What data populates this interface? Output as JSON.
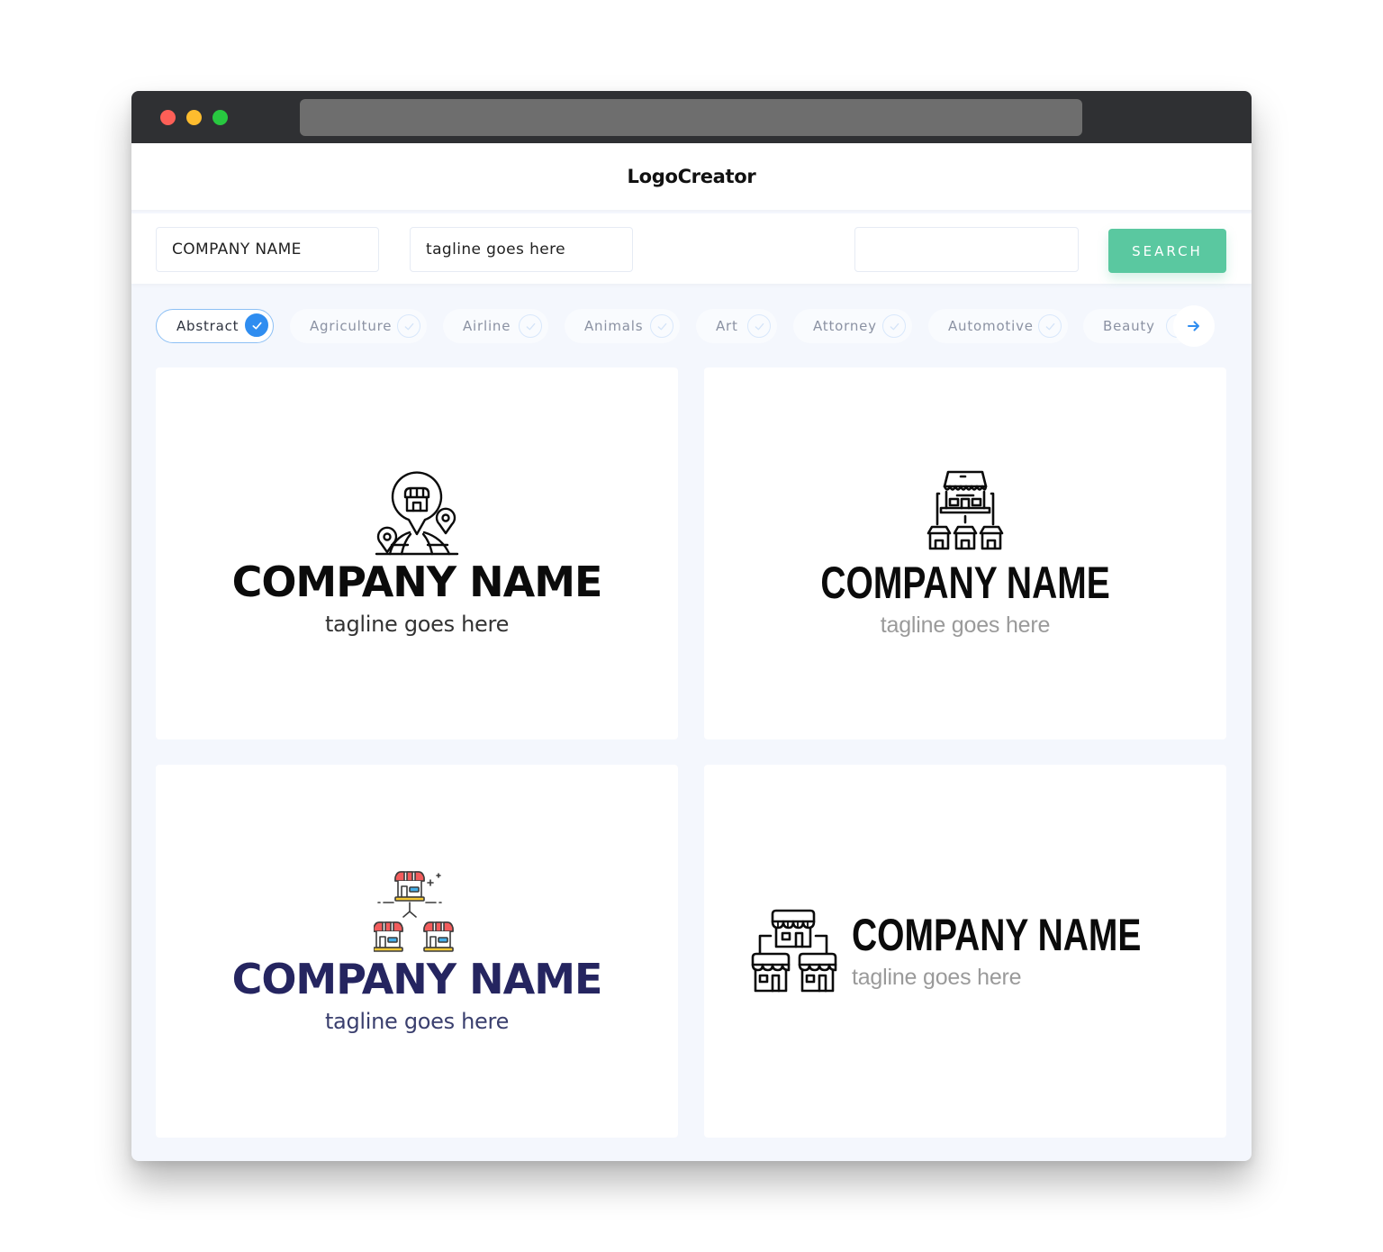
{
  "window": {
    "traffic_lights": [
      "close",
      "minimize",
      "maximize"
    ],
    "url": ""
  },
  "header": {
    "brand": "LogoCreator"
  },
  "search": {
    "company_name_value": "COMPANY NAME",
    "tagline_value": "tagline goes here",
    "keyword_value": "",
    "search_button_label": "SEARCH",
    "accent_color": "#5ac8a0"
  },
  "categories": {
    "items": [
      {
        "label": "Abstract",
        "selected": true
      },
      {
        "label": "Agriculture",
        "selected": false
      },
      {
        "label": "Airline",
        "selected": false
      },
      {
        "label": "Animals",
        "selected": false
      },
      {
        "label": "Art",
        "selected": false
      },
      {
        "label": "Attorney",
        "selected": false
      },
      {
        "label": "Automotive",
        "selected": false
      },
      {
        "label": "Beauty",
        "selected": false
      }
    ],
    "next_icon": "arrow-right-icon",
    "selected_color": "#2f8df0"
  },
  "logos": [
    {
      "icon": "globe-store-pin-icon",
      "company": "COMPANY NAME",
      "tagline": "tagline goes here",
      "layout": "stacked",
      "color": "#0b0b0b"
    },
    {
      "icon": "store-network-icon",
      "company": "COMPANY NAME",
      "tagline": "tagline goes here",
      "layout": "stacked",
      "color": "#0b0b0b"
    },
    {
      "icon": "colored-store-network-icon",
      "company": "COMPANY NAME",
      "tagline": "tagline goes here",
      "layout": "stacked",
      "color": "#252560"
    },
    {
      "icon": "store-branches-icon",
      "company": "COMPANY NAME",
      "tagline": "tagline goes here",
      "layout": "inline",
      "color": "#0b0b0b"
    }
  ]
}
